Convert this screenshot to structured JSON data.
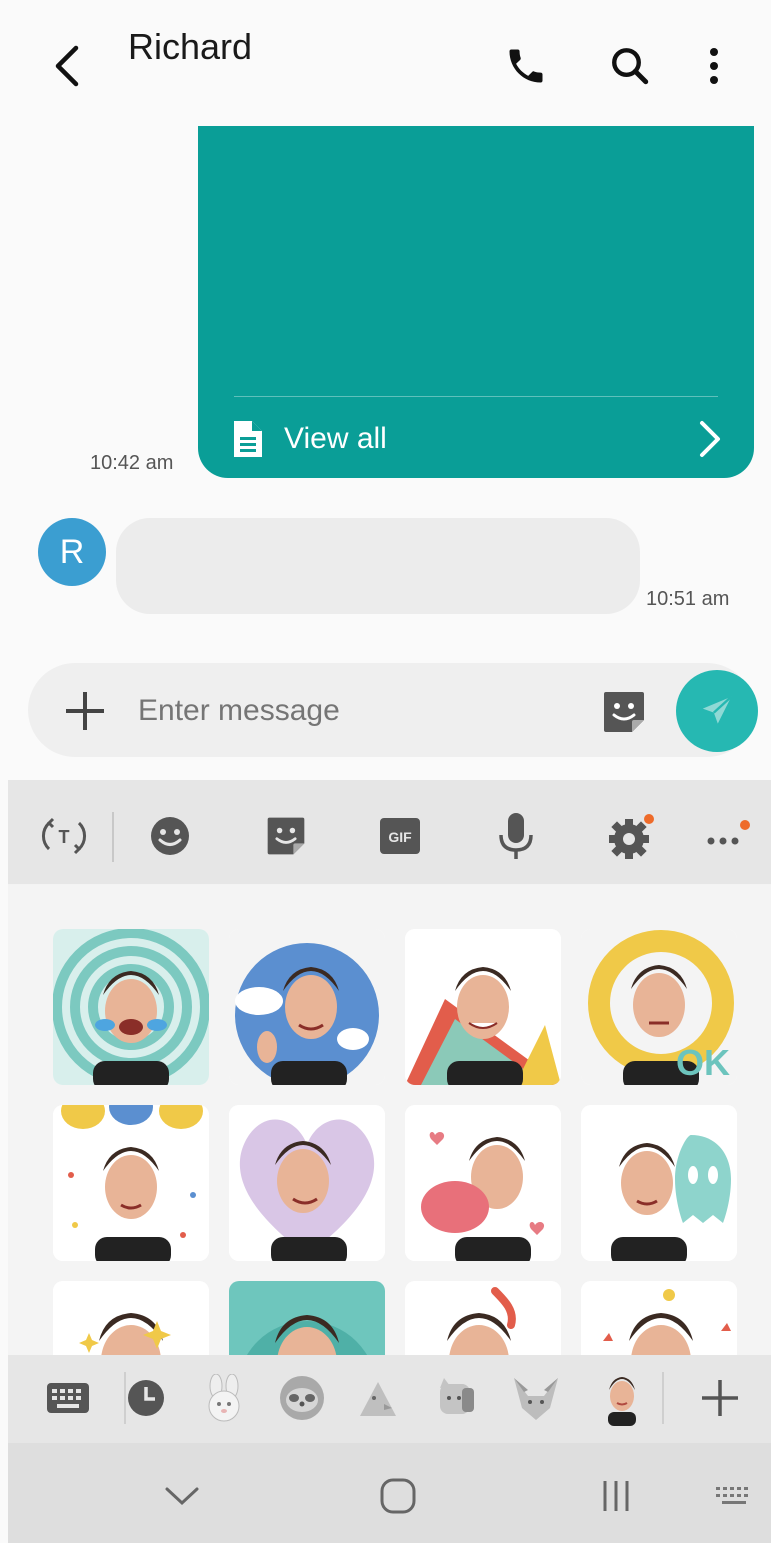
{
  "header": {
    "contact_name": "Richard",
    "back_icon": "chevron-left-icon",
    "call_icon": "phone-icon",
    "search_icon": "search-icon",
    "more_icon": "more-vertical-icon"
  },
  "messages": {
    "sent": {
      "time": "10:42 am",
      "view_all_label": "View all",
      "color": "#0a9e97"
    },
    "received": {
      "avatar_letter": "R",
      "time": "10:51 am",
      "avatar_color": "#3b9ed1"
    }
  },
  "composer": {
    "placeholder": "Enter message",
    "send_color": "#26b8b2"
  },
  "keyboard_toolbar": {
    "items": [
      "translate-icon",
      "emoji-icon",
      "sticker-icon",
      "gif-icon",
      "mic-icon",
      "settings-icon",
      "more-horizontal-icon"
    ],
    "gif_label": "GIF"
  },
  "stickers": {
    "pack": "AR Emoji",
    "ok_text": "OK"
  },
  "sticker_categories": [
    "keyboard-icon",
    "recent-icon",
    "bunny-icon",
    "sloth-icon",
    "bird-icon",
    "cat-icon",
    "fox-icon",
    "ar-emoji-avatar-icon",
    "add-icon"
  ],
  "nav": [
    "nav-hide-keyboard-icon",
    "nav-home-icon",
    "nav-recents-icon",
    "nav-keyboard-icon"
  ]
}
